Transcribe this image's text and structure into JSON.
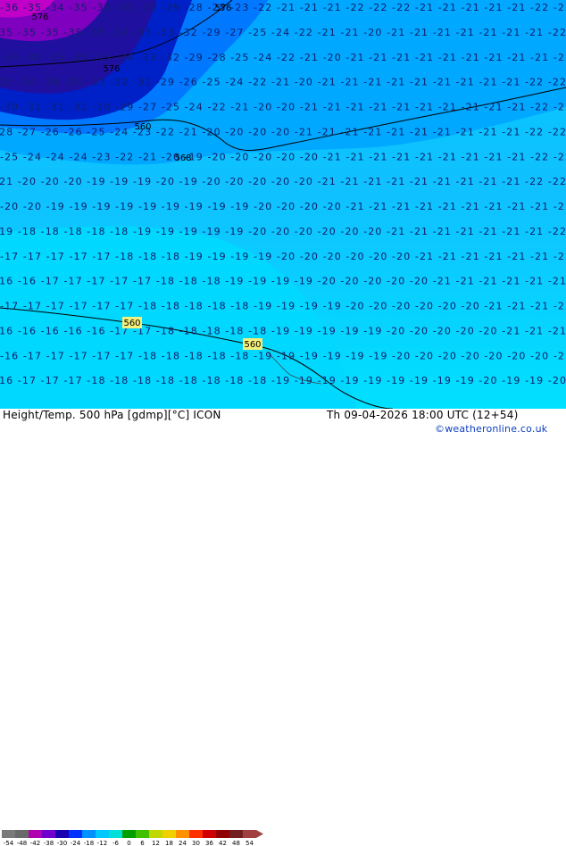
{
  "map": {
    "contour_labels": [
      "560",
      "560",
      "560",
      "568",
      "576",
      "576",
      "576"
    ],
    "temperature_rows": [
      "-36 -35 -34 -35 -35 -33 -30 -29 -28 -25 -23 -22 -21 -21 -21 -22 -22 -22 -21 -21 -21 -21 -21 -22 -22",
      "-35 -35 -35 -35 -35 -34 -33 -33 -32 -29 -27 -25 -24 -22 -21 -21 -20 -21 -21 -21 -21 -21 -21 -21 -22",
      "-34 -35 -35 -35 -35 -34 -33 -32 -29 -28 -25 -24 -22 -21 -20 -21 -21 -21 -21 -21 -21 -21 -21 -21 -22",
      "-33 -34 -34 -34 -33 -32 -31 -29 -26 -25 -24 -22 -21 -20 -21 -21 -21 -21 -21 -21 -21 -21 -21 -22 -22",
      "-30 -31 -31 -32 -30 -29 -27 -25 -24 -22 -21 -20 -20 -21 -21 -21 -21 -21 -21 -21 -21 -21 -21 -22 -22",
      "-28 -27 -26 -26 -25 -24 -23 -22 -21 -20 -20 -20 -20 -21 -21 -21 -21 -21 -21 -21 -21 -21 -21 -22 -22",
      "-25 -24 -24 -24 -23 -22 -21 -20 -19 -20 -20 -20 -20 -20 -21 -21 -21 -21 -21 -21 -21 -21 -21 -22 -22",
      "-21 -20 -20 -20 -19 -19 -19 -20 -19 -20 -20 -20 -20 -20 -21 -21 -21 -21 -21 -21 -21 -21 -21 -22 -22",
      "-20 -20 -19 -19 -19 -19 -19 -19 -19 -19 -19 -20 -20 -20 -20 -21 -21 -21 -21 -21 -21 -21 -21 -21 -22",
      "-19 -18 -18 -18 -18 -18 -19 -19 -19 -19 -19 -20 -20 -20 -20 -20 -20 -21 -21 -21 -21 -21 -21 -21 -22",
      "-17 -17 -17 -17 -17 -18 -18 -18 -19 -19 -19 -19 -20 -20 -20 -20 -20 -20 -21 -21 -21 -21 -21 -21 -22",
      "-16 -16 -17 -17 -17 -17 -17 -18 -18 -18 -19 -19 -19 -19 -20 -20 -20 -20 -20 -21 -21 -21 -21 -21 -21",
      "-17 -17 -17 -17 -17 -17 -18 -18 -18 -18 -18 -19 -19 -19 -19 -20 -20 -20 -20 -20 -20 -21 -21 -21 -22",
      "-16 -16 -16 -16 -16 -17 -17 -18 -18 -18 -18 -18 -19 -19 -19 -19 -19 -20 -20 -20 -20 -20 -21 -21 -21",
      "-16 -17 -17 -17 -17 -17 -18 -18 -18 -18 -18 -19 -19 -19 -19 -19 -19 -20 -20 -20 -20 -20 -20 -20 -21",
      "-16 -17 -17 -17 -18 -18 -18 -18 -18 -18 -18 -18 -19 -19 -19 -19 -19 -19 -19 -19 -19 -20 -19 -19 -20"
    ]
  },
  "footer": {
    "title": "Height/Temp. 500 hPa [gdmp][°C] ICON",
    "datetime": "Th 09-04-2026 18:00 UTC (12+54)",
    "credit": "©weatheronline.co.uk",
    "scale": {
      "labels": [
        "-54",
        "-48",
        "-42",
        "-38",
        "-30",
        "-24",
        "-18",
        "-12",
        "-6",
        "0",
        "6",
        "12",
        "18",
        "24",
        "30",
        "36",
        "42",
        "48",
        "54"
      ],
      "colors": [
        "#7a7a7a",
        "#6a6a6a",
        "#b000b0",
        "#7000d0",
        "#1800b0",
        "#0030ff",
        "#0090ff",
        "#00c8ff",
        "#00e0d8",
        "#00a000",
        "#40c000",
        "#c0d800",
        "#f0d000",
        "#ff9000",
        "#ff3000",
        "#d00000",
        "#900000",
        "#702020",
        "#a04040"
      ]
    }
  }
}
